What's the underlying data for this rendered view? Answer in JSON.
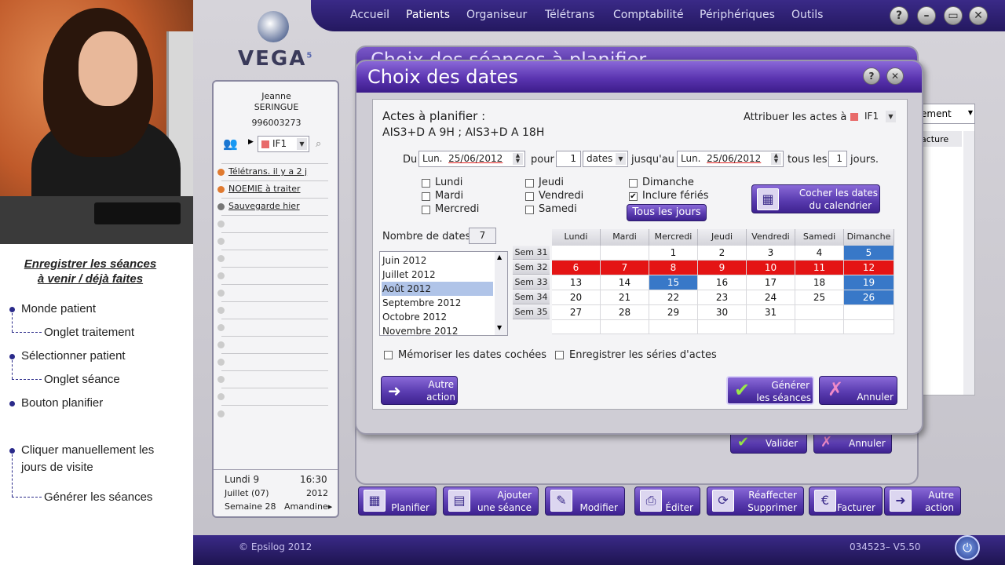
{
  "tutorial": {
    "title": "Enregistrer les séances\nà venir / déjà faites",
    "steps": [
      "Monde patient",
      "Onglet traitement",
      "Sélectionner patient",
      "Onglet séance",
      "Bouton planifier",
      "Cliquer manuellement les",
      "jours de visite",
      "Générer les séances"
    ]
  },
  "app": {
    "logo": "VEGA",
    "logo_sup": "5",
    "menu": [
      "Accueil",
      "Patients",
      "Organiseur",
      "Télétrans",
      "Comptabilité",
      "Périphériques",
      "Outils"
    ],
    "window_buttons": [
      "?",
      "–",
      "▭",
      "✕"
    ]
  },
  "patient": {
    "first": "Jeanne",
    "last": "SERINGUE",
    "number": "996003273",
    "ide": "IF1"
  },
  "notes": [
    "Télétrans. il y a 2 j",
    "NOEMIE à traiter",
    "Sauvegarde hier"
  ],
  "status": {
    "day": "Lundi 9",
    "time": "16:30",
    "month": "Juillet (07)",
    "year": "2012",
    "week": "Semaine 28",
    "user": "Amandine"
  },
  "bg_dialog": {
    "title": "Choix des séances à planifier",
    "dropdown": "ement",
    "column": "acture",
    "valider": "Valider",
    "annuler": "Annuler"
  },
  "dialog": {
    "title": "Choix des dates",
    "help": "?",
    "close": "✕",
    "actes_label": "Actes à planifier :",
    "actes_value": "AIS3+D A 9H ; AIS3+D A 18H",
    "attribuer_label": "Attribuer les actes à",
    "attribuer_value": "IF1",
    "du_label": "Du",
    "du_day": "Lun.",
    "du_date": "25/06/2012",
    "pour_label": "pour",
    "pour_value": "1",
    "unit_value": "dates",
    "jusquau_label": "jusqu'au",
    "jusquau_day": "Lun.",
    "jusquau_date": "25/06/2012",
    "tous_les_label": "tous les",
    "tous_les_value": "1",
    "jours_label": "jours.",
    "days": [
      {
        "label": "Lundi",
        "checked": false
      },
      {
        "label": "Mardi",
        "checked": false
      },
      {
        "label": "Mercredi",
        "checked": false
      },
      {
        "label": "Jeudi",
        "checked": false
      },
      {
        "label": "Vendredi",
        "checked": false
      },
      {
        "label": "Samedi",
        "checked": false
      },
      {
        "label": "Dimanche",
        "checked": false
      },
      {
        "label": "Inclure fériés",
        "checked": true
      }
    ],
    "tous_les_jours": "Tous les jours",
    "cocher_line1": "Cocher les dates",
    "cocher_line2": "du calendrier",
    "nombre_label": "Nombre de dates",
    "nombre_value": "7",
    "months": [
      "Juin 2012",
      "Juillet 2012",
      "Août 2012",
      "Septembre 2012",
      "Octobre 2012",
      "Novembre 2012"
    ],
    "selected_month": "Août 2012",
    "cal_headers": [
      "Lundi",
      "Mardi",
      "Mercredi",
      "Jeudi",
      "Vendredi",
      "Samedi",
      "Dimanche"
    ],
    "weeks": [
      "Sem 31",
      "Sem 32",
      "Sem 33",
      "Sem 34",
      "Sem 35"
    ],
    "cal_rows": [
      [
        "",
        "",
        "1",
        "2",
        "3",
        "4",
        "5"
      ],
      [
        "6",
        "7",
        "8",
        "9",
        "10",
        "11",
        "12"
      ],
      [
        "13",
        "14",
        "15",
        "16",
        "17",
        "18",
        "19"
      ],
      [
        "20",
        "21",
        "22",
        "23",
        "24",
        "25",
        "26"
      ],
      [
        "27",
        "28",
        "29",
        "30",
        "31",
        "",
        ""
      ]
    ],
    "cal_states": [
      [
        "",
        "",
        "",
        "",
        "",
        "",
        "blue"
      ],
      [
        "red",
        "red",
        "red",
        "red",
        "red",
        "red",
        "red"
      ],
      [
        "",
        "",
        "blue",
        "",
        "",
        "",
        "blue"
      ],
      [
        "",
        "",
        "",
        "",
        "",
        "",
        "blue"
      ],
      [
        "",
        "",
        "",
        "",
        "",
        "",
        ""
      ]
    ],
    "memoriser": "Mémoriser les dates cochées",
    "enregistrer": "Enregistrer les séries d'actes",
    "autre_action_1": "Autre",
    "autre_action_2": "action",
    "generer_1": "Générer",
    "generer_2": "les séances",
    "annuler": "Annuler"
  },
  "toolbar": [
    {
      "l1": "",
      "l2": "Planifier",
      "icon": "▦"
    },
    {
      "l1": "Ajouter",
      "l2": "une séance",
      "icon": "▤"
    },
    {
      "l1": "",
      "l2": "Modifier",
      "icon": "✎"
    },
    {
      "l1": "",
      "l2": "Éditer",
      "icon": "⎙"
    },
    {
      "l1": "Réaffecter",
      "l2": "Supprimer",
      "icon": "⟳"
    },
    {
      "l1": "",
      "l2": "Facturer",
      "icon": "€"
    },
    {
      "l1": "Autre",
      "l2": "action",
      "icon": "➜"
    }
  ],
  "footer": {
    "copyright": "© Epsilog 2012",
    "version": "034523– V5.50"
  }
}
